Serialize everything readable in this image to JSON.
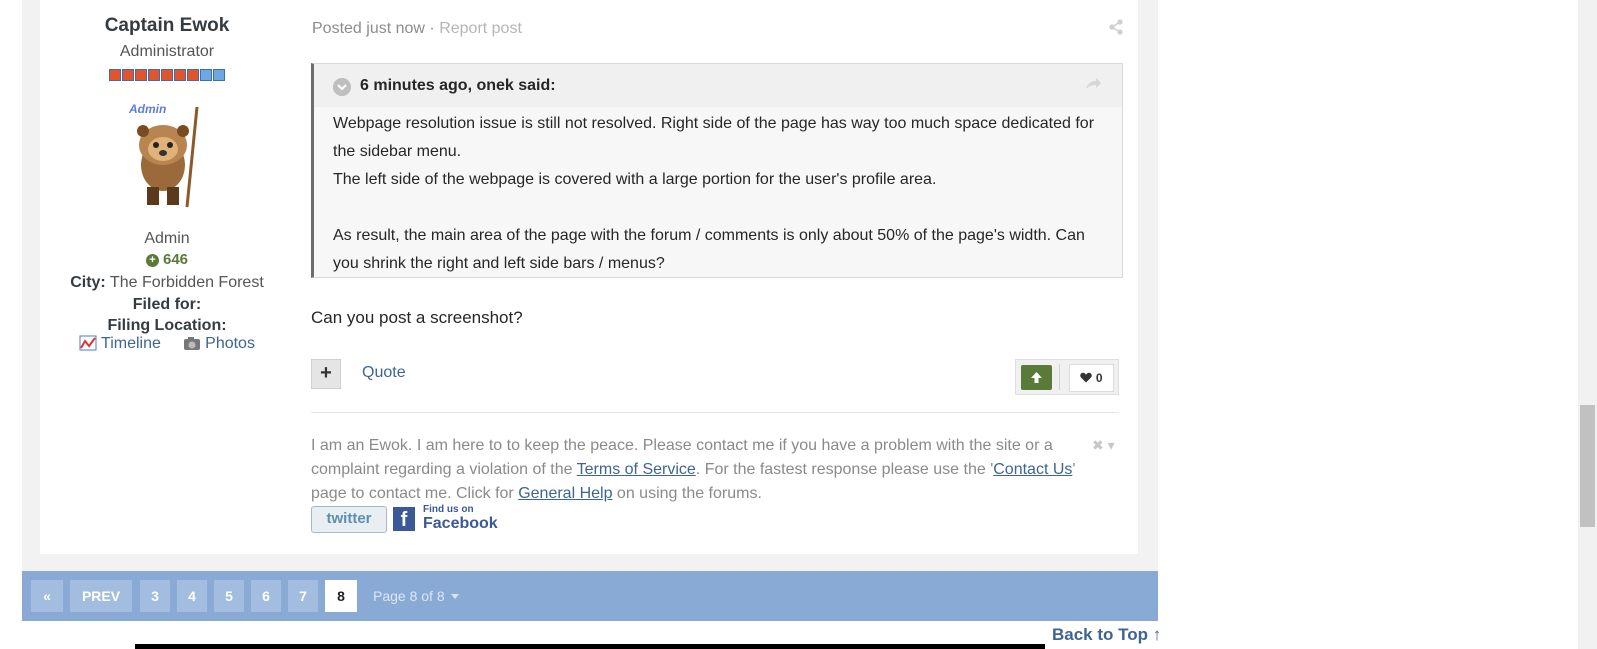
{
  "author": {
    "name": "Captain Ewok",
    "role": "Administrator",
    "avatar_label": "Admin",
    "group": "Admin",
    "reputation": "646",
    "city_label": "City:",
    "city_value": "The Forbidden Forest",
    "filed_for_label": "Filed for:",
    "filing_location_label": "Filing Location:",
    "timeline_label": "Timeline",
    "photos_label": "Photos",
    "rank": {
      "filled": 7,
      "total": 9,
      "filled_color": "#e2552c",
      "empty_color": "#6fa7e2"
    }
  },
  "post": {
    "posted": "Posted just now",
    "separator": "·",
    "report": "Report post",
    "quote": {
      "citation": "6 minutes ago, onek said:",
      "lines": [
        "Webpage resolution issue is still not resolved.  Right side of the page has way too much space dedicated for the sidebar menu.",
        "The left side of the webpage is covered with a large portion for the user's profile area.",
        "",
        "As result, the main area of the page with the forum / comments is only about 50% of the page's width. Can you shrink the right and left side bars / menus?"
      ]
    },
    "reply": "Can you post a screenshot?",
    "quote_button": "Quote",
    "like_count": "0"
  },
  "signature": {
    "part1": "I am an Ewok. I am here to to keep the peace. Please contact me if you have a problem with the site or a complaint regarding a violation of the ",
    "tos_link": "Terms of Service",
    "part2": ". For the fastest response please use the '",
    "contact_link": "Contact Us",
    "part3": "' page to contact me. Click for ",
    "help_link": "General Help",
    "part4": " on using the forums.",
    "twitter": "twitter",
    "fb_find": "Find us on",
    "fb_word": "Facebook"
  },
  "pagination": {
    "prev": "PREV",
    "pages": [
      "3",
      "4",
      "5",
      "6",
      "7",
      "8"
    ],
    "current": "8",
    "page_of": "Page 8 of 8"
  },
  "back_to_top": "Back to Top ↑",
  "colors": {
    "accent": "#3d6594",
    "pager_bg": "#8aaad6",
    "upvote": "#5a7a3a"
  }
}
